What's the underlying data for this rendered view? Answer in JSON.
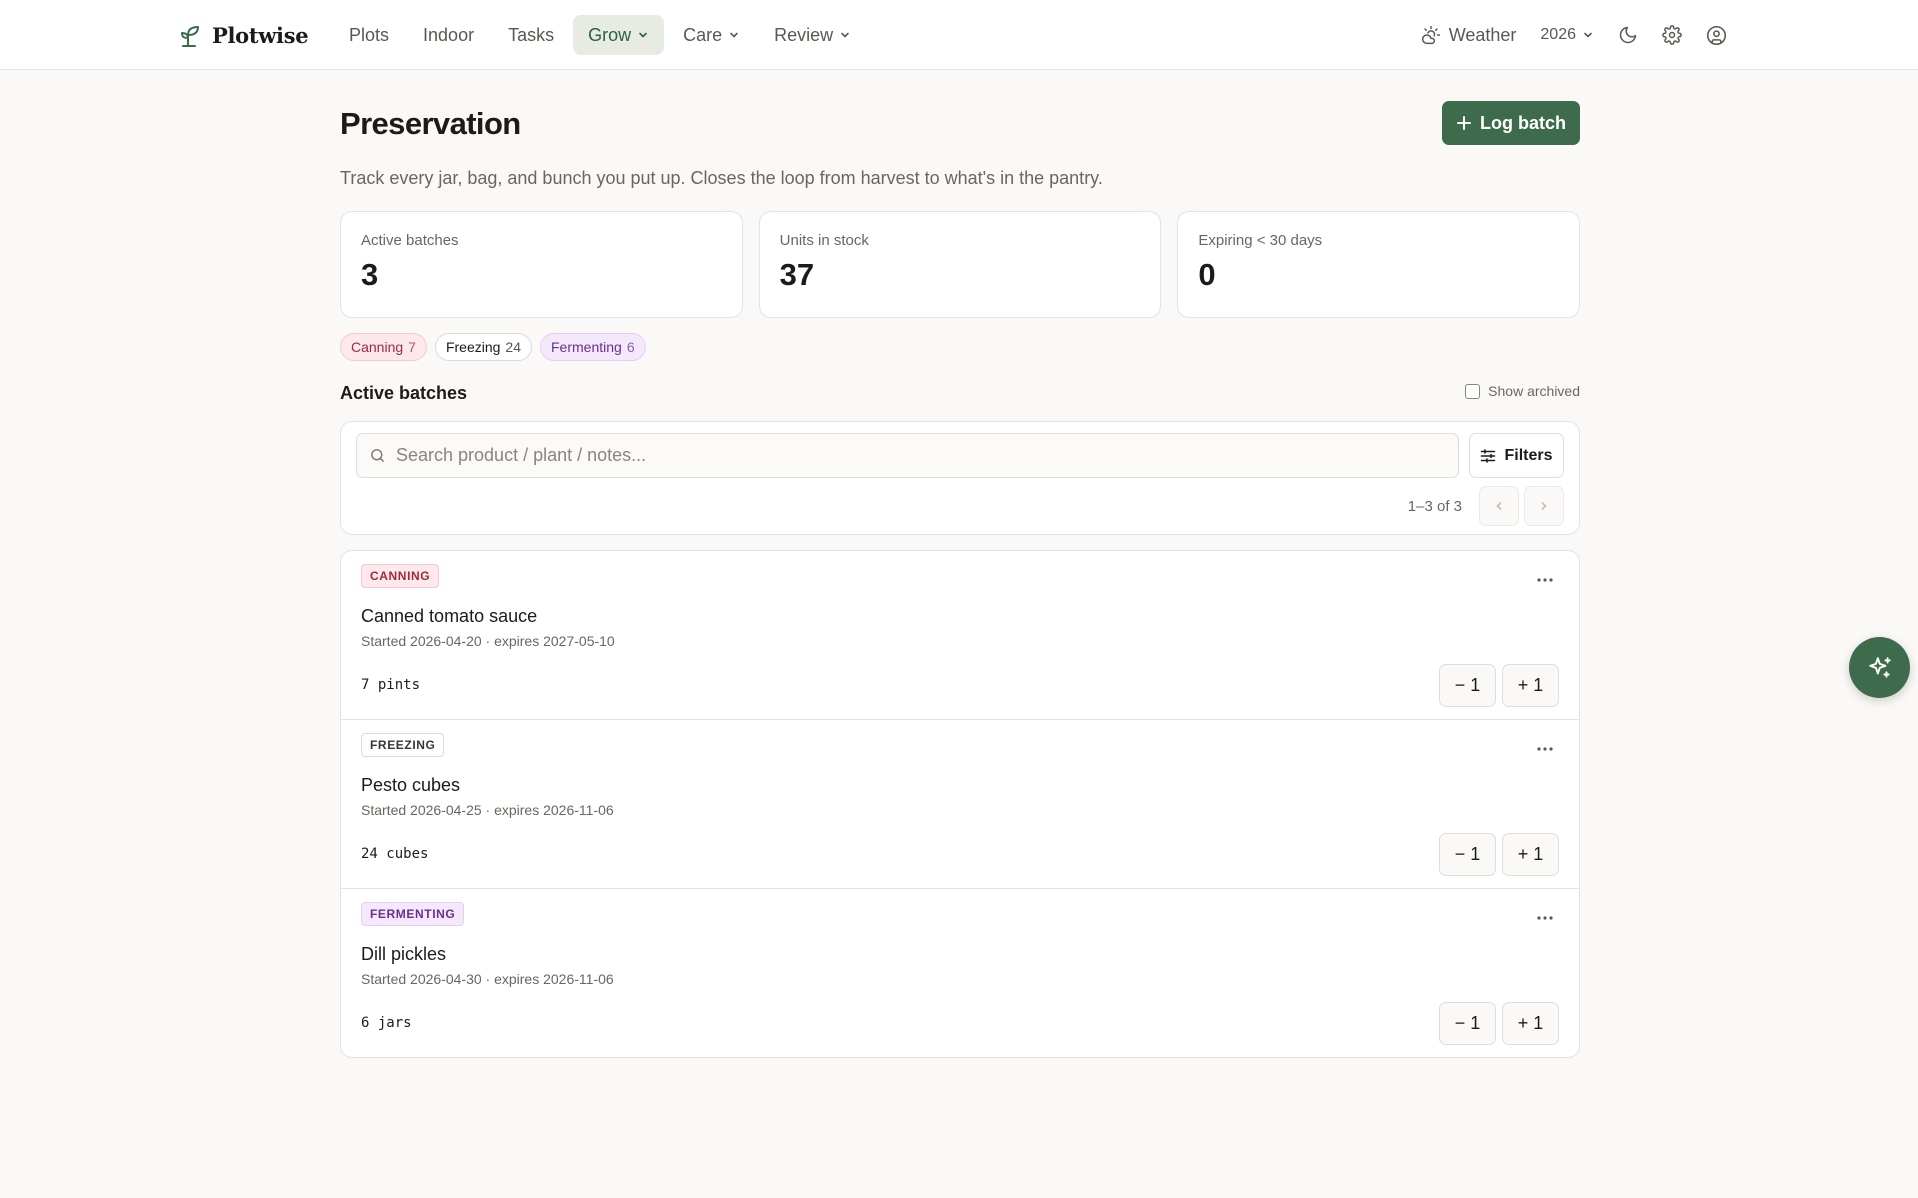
{
  "brand": {
    "name": "Plotwise",
    "accent": "#3d6b4c"
  },
  "nav": {
    "items": [
      {
        "label": "Plots",
        "dropdown": false,
        "active": false
      },
      {
        "label": "Indoor",
        "dropdown": false,
        "active": false
      },
      {
        "label": "Tasks",
        "dropdown": false,
        "active": false
      },
      {
        "label": "Grow",
        "dropdown": true,
        "active": true
      },
      {
        "label": "Care",
        "dropdown": true,
        "active": false
      },
      {
        "label": "Review",
        "dropdown": true,
        "active": false
      }
    ],
    "weather_label": "Weather",
    "year": "2026"
  },
  "page": {
    "title": "Preservation",
    "log_button": "Log batch",
    "subtitle": "Track every jar, bag, and bunch you put up. Closes the loop from harvest to what's in the pantry."
  },
  "stats": [
    {
      "label": "Active batches",
      "value": "3"
    },
    {
      "label": "Units in stock",
      "value": "37"
    },
    {
      "label": "Expiring < 30 days",
      "value": "0"
    }
  ],
  "chips": [
    {
      "label": "Canning",
      "count": "7",
      "bg": "#fde8ec",
      "border": "#f5c9d2",
      "color": "#9e2a3f"
    },
    {
      "label": "Freezing",
      "count": "24",
      "bg": "#ffffff",
      "border": "#dedad4",
      "color": "#1c1b19"
    },
    {
      "label": "Fermenting",
      "count": "6",
      "bg": "#f4e8fb",
      "border": "#e5cdf3",
      "color": "#6b2e8f"
    }
  ],
  "section": {
    "title": "Active batches",
    "show_archived": "Show archived",
    "show_archived_checked": false
  },
  "search": {
    "placeholder": "Search product / plant / notes...",
    "filters_label": "Filters",
    "range": "1–3 of 3"
  },
  "batches": [
    {
      "method": "CANNING",
      "name": "Canned tomato sauce",
      "dates": "Started 2026-04-20 · expires 2027-05-10",
      "qty": "7 pints",
      "badge_bg": "#fde8ec",
      "badge_border": "#f5c9d2",
      "badge_color": "#9e2a3f"
    },
    {
      "method": "FREEZING",
      "name": "Pesto cubes",
      "dates": "Started 2026-04-25 · expires 2026-11-06",
      "qty": "24 cubes",
      "badge_bg": "#ffffff",
      "badge_border": "#dedad4",
      "badge_color": "#3a3631"
    },
    {
      "method": "FERMENTING",
      "name": "Dill pickles",
      "dates": "Started 2026-04-30 · expires 2026-11-06",
      "qty": "6 jars",
      "badge_bg": "#f4e8fb",
      "badge_border": "#e5cdf3",
      "badge_color": "#6b2e8f"
    }
  ],
  "qty_buttons": {
    "minus": "− 1",
    "plus": "+ 1"
  },
  "icons": {
    "brand": "sprout-icon",
    "weather": "sun-cloud-icon",
    "theme": "moon-icon",
    "settings": "gear-icon",
    "account": "user-circle-icon",
    "add": "plus-icon",
    "search": "search-icon",
    "filters": "sliders-icon",
    "prev": "chevron-left-icon",
    "next": "chevron-right-icon",
    "more": "ellipsis-icon",
    "assistant": "sparkles-icon"
  }
}
